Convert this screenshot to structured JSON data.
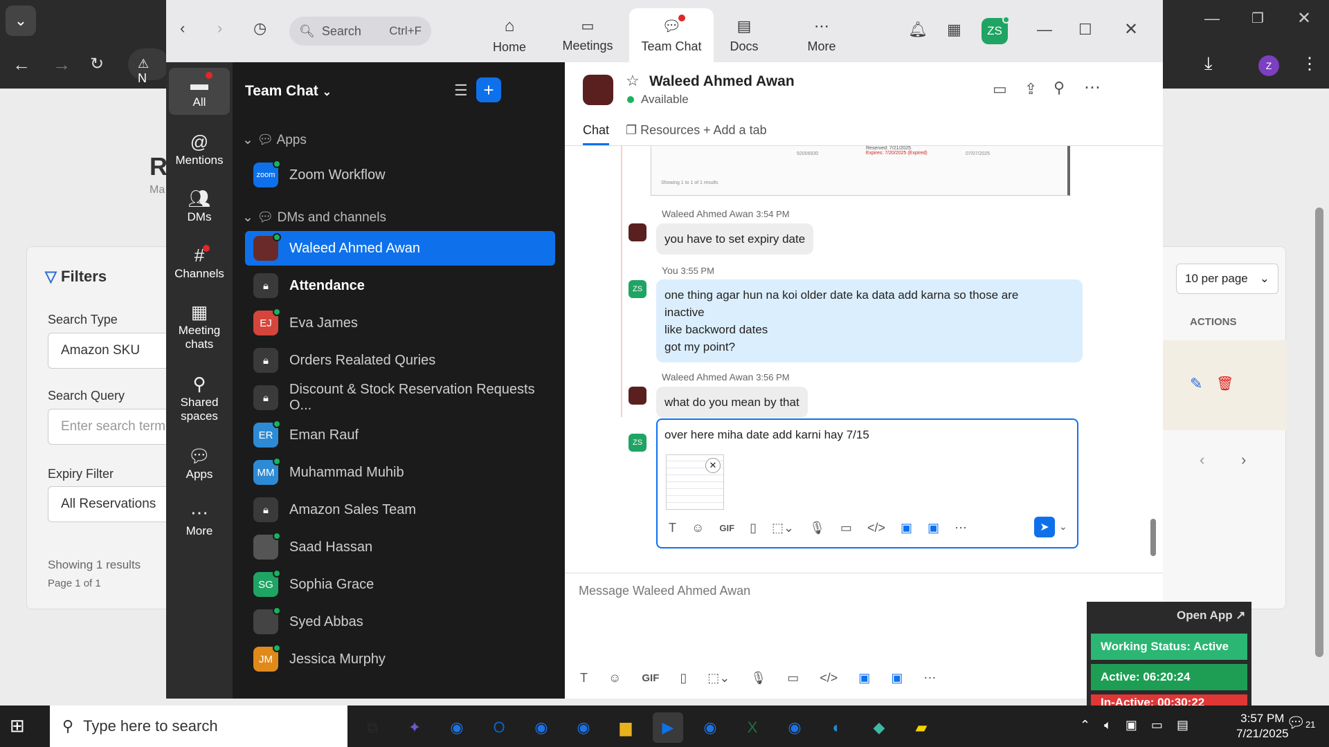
{
  "bg": {
    "title_letter": "R",
    "sub_letter": "Ma",
    "filters": "Filters",
    "search_type_label": "Search Type",
    "search_type_value": "Amazon SKU",
    "search_query_label": "Search Query",
    "search_query_placeholder": "Enter search term...",
    "expiry_label": "Expiry Filter",
    "expiry_value": "All Reservations",
    "showing": "Showing 1 results",
    "page": "Page 1 of 1",
    "per_page": "10 per page",
    "actions": "ACTIONS",
    "tab_letter": "N"
  },
  "titlebar": {
    "search_placeholder": "Search",
    "search_shortcut": "Ctrl+F",
    "tabs": [
      {
        "label": "Home"
      },
      {
        "label": "Meetings"
      },
      {
        "label": "Team Chat"
      },
      {
        "label": "Docs"
      },
      {
        "label": "More"
      }
    ],
    "avatar": "ZS"
  },
  "rail": [
    {
      "label": "All"
    },
    {
      "label": "Mentions"
    },
    {
      "label": "DMs"
    },
    {
      "label": "Channels"
    },
    {
      "label": "Meeting chats"
    },
    {
      "label": "Shared spaces"
    },
    {
      "label": "Apps"
    },
    {
      "label": "More"
    }
  ],
  "sidebar": {
    "title": "Team Chat",
    "sections": {
      "apps": "Apps",
      "dms": "DMs and channels"
    },
    "app_item": "Zoom Workflow",
    "zoom_logo": "zoom",
    "items": [
      {
        "label": "Waleed Ahmed Awan",
        "initials": "",
        "color": "#6b2a2a"
      },
      {
        "label": "Attendance",
        "initials": "",
        "color": "#3a3a3a"
      },
      {
        "label": "Eva James",
        "initials": "EJ",
        "color": "#d6453b"
      },
      {
        "label": "Orders Realated Quries",
        "initials": "",
        "color": "#3a3a3a"
      },
      {
        "label": "Discount & Stock Reservation Requests O...",
        "initials": "",
        "color": "#3a3a3a"
      },
      {
        "label": "Eman Rauf",
        "initials": "ER",
        "color": "#2d8bd6"
      },
      {
        "label": "Muhammad Muhib",
        "initials": "MM",
        "color": "#2d8bd6"
      },
      {
        "label": "Amazon Sales Team",
        "initials": "",
        "color": "#3a3a3a"
      },
      {
        "label": "Saad Hassan",
        "initials": "",
        "color": "#555"
      },
      {
        "label": "Sophia Grace",
        "initials": "SG",
        "color": "#1fa463"
      },
      {
        "label": "Syed Abbas",
        "initials": "",
        "color": "#444"
      },
      {
        "label": "Jessica Murphy",
        "initials": "JM",
        "color": "#e08a1c"
      }
    ]
  },
  "chat": {
    "name": "Waleed Ahmed Awan",
    "status": "Available",
    "tabs": {
      "chat": "Chat",
      "resources": "Resources",
      "add": "Add a tab"
    },
    "messages": [
      {
        "sender": "Waleed Ahmed Awan",
        "time": "3:54 PM",
        "text": "you have to set expiry date"
      },
      {
        "sender": "You",
        "time": "3:55 PM",
        "lines": [
          "one thing agar hun na koi older date ka data add karna so those are",
          "inactive",
          "like backword dates",
          "got my point?"
        ]
      },
      {
        "sender": "Waleed Ahmed Awan",
        "time": "3:56 PM",
        "text": "what do you mean by that"
      }
    ],
    "draft": "over here miha date add karni hay 7/15",
    "me_initials": "ZS",
    "compose_placeholder": "Message Waleed Ahmed Awan",
    "gif": "GIF"
  },
  "screenshot_preview": {
    "reserved": "Reserved: 7/21/2025",
    "expired": "Expires: 7/20/2025",
    "expired_tag": "(Expired)",
    "num": "92006930",
    "date": "07/07/2025",
    "showing": "Showing 1 to 1 of 1 results"
  },
  "overlay": {
    "open_app": "Open App ↗",
    "working": "Working Status: Active",
    "active": "Active: 06:20:24",
    "inactive": "In-Active: 00:30:22"
  },
  "taskbar": {
    "search": "Type here to search",
    "time": "3:57 PM",
    "date": "7/21/2025",
    "badge": "21"
  }
}
